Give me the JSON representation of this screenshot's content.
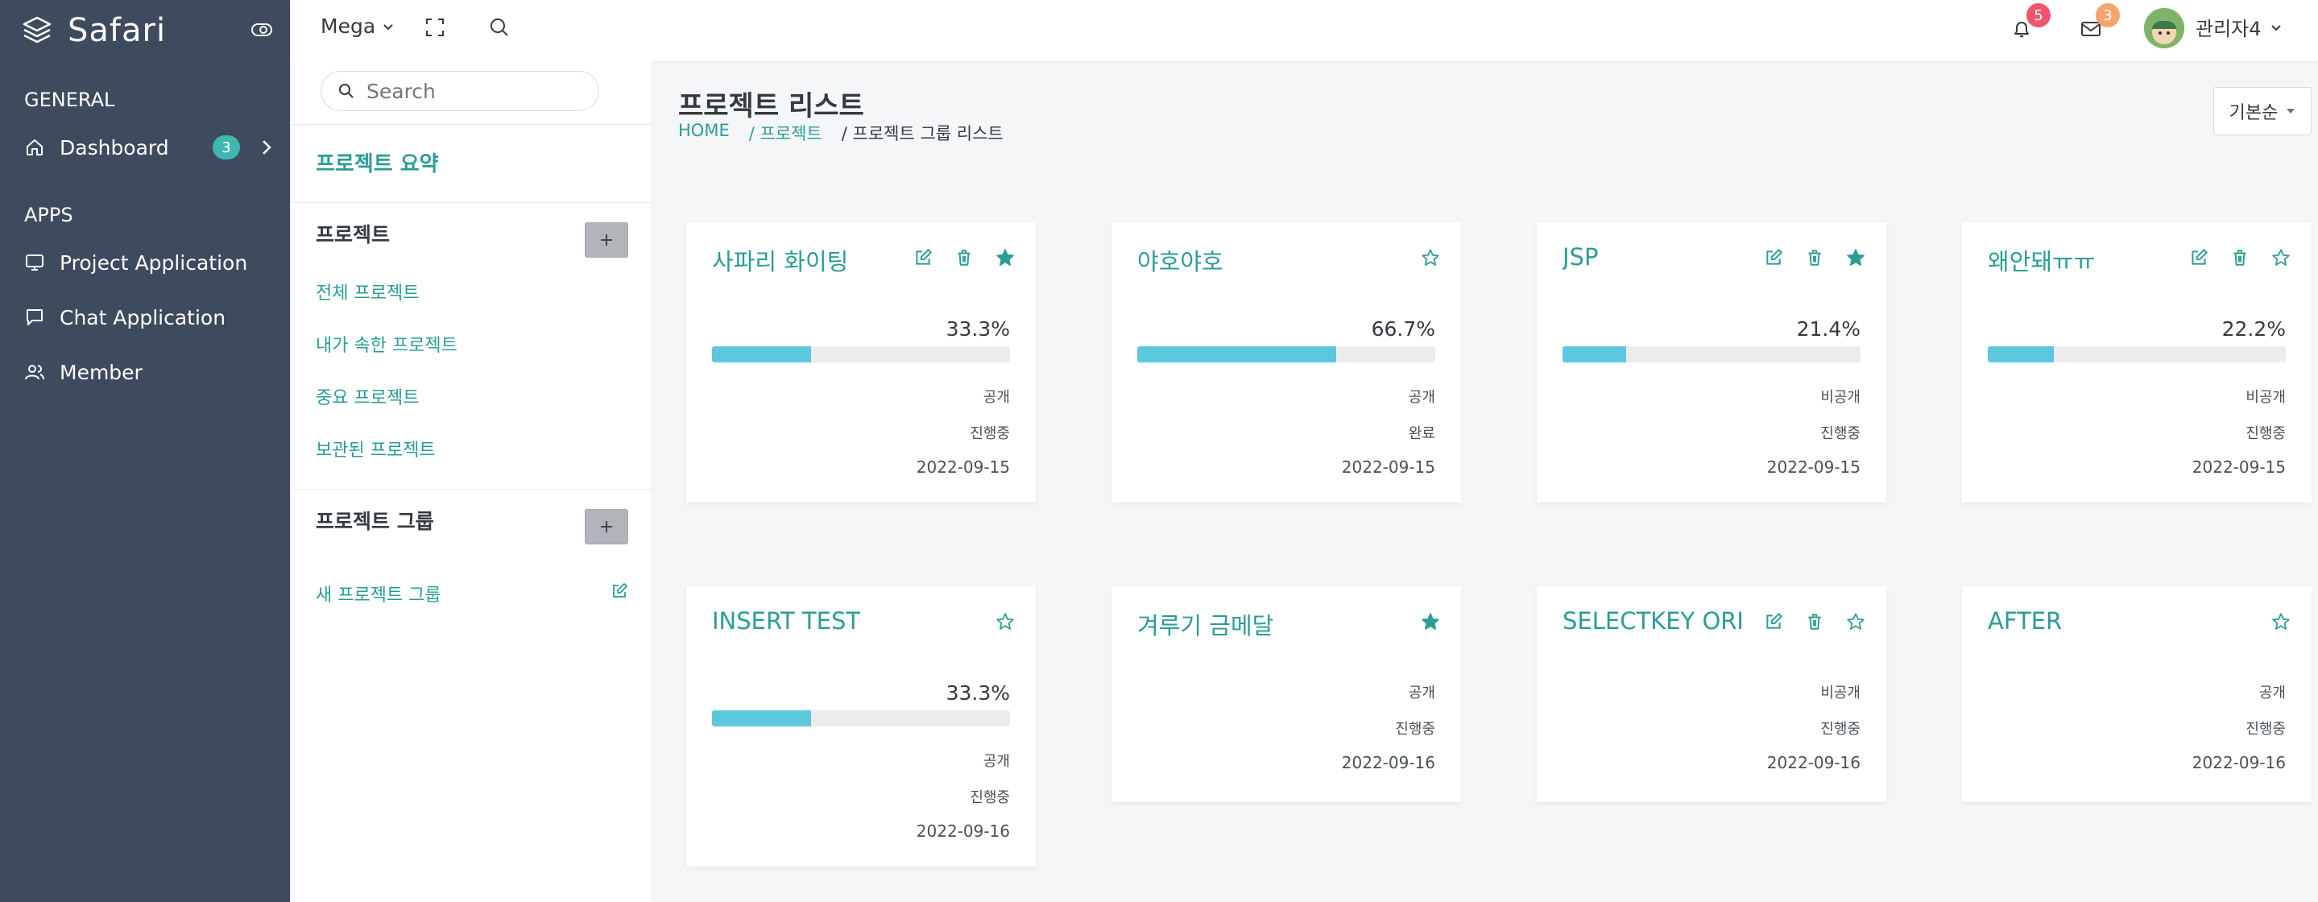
{
  "brand": {
    "name": "Safari"
  },
  "sidebar": {
    "general_title": "GENERAL",
    "dashboard_label": "Dashboard",
    "dashboard_badge": "3",
    "apps_title": "APPS",
    "apps": [
      {
        "label": "Project Application",
        "icon": "monitor-icon"
      },
      {
        "label": "Chat Application",
        "icon": "chat-icon"
      },
      {
        "label": "Member",
        "icon": "users-icon"
      }
    ]
  },
  "topbar": {
    "mega_label": "Mega",
    "notif_count": "5",
    "mail_count": "3",
    "username": "관리자4",
    "colors": {
      "notif": "#f1556c",
      "mail": "#f7a56d"
    }
  },
  "panel": {
    "search_placeholder": "Search",
    "summary_link": "프로젝트 요약",
    "projects_head": "프로젝트",
    "project_links": [
      "전체 프로젝트",
      "내가 속한 프로젝트",
      "중요 프로젝트",
      "보관된 프로젝트"
    ],
    "groups_head": "프로젝트 그룹",
    "new_group_link": "새 프로젝트 그룹"
  },
  "main": {
    "title": "프로젝트 리스트",
    "breadcrumb": [
      "HOME",
      "/ 프로젝트",
      "/ 프로젝트 그룹 리스트"
    ],
    "sort_label": "기본순"
  },
  "cards": [
    {
      "title": "사파리 화이팅",
      "editable": true,
      "starred": true,
      "progress_text": "33.3%",
      "progress": 0.333,
      "visibility": "공개",
      "status": "진행중",
      "date": "2022-09-15"
    },
    {
      "title": "야호야호",
      "editable": false,
      "starred": false,
      "progress_text": "66.7%",
      "progress": 0.667,
      "visibility": "공개",
      "status": "완료",
      "date": "2022-09-15"
    },
    {
      "title": "JSP",
      "editable": true,
      "starred": true,
      "progress_text": "21.4%",
      "progress": 0.214,
      "visibility": "비공개",
      "status": "진행중",
      "date": "2022-09-15"
    },
    {
      "title": "왜안돼ㅠㅠ",
      "editable": true,
      "starred": false,
      "progress_text": "22.2%",
      "progress": 0.222,
      "visibility": "비공개",
      "status": "진행중",
      "date": "2022-09-15"
    },
    {
      "title": "INSERT TEST",
      "editable": false,
      "starred": false,
      "progress_text": "33.3%",
      "progress": 0.333,
      "visibility": "공개",
      "status": "진행중",
      "date": "2022-09-16"
    },
    {
      "title": "겨루기 금메달",
      "editable": false,
      "starred": true,
      "progress_text": "",
      "progress": null,
      "visibility": "공개",
      "status": "진행중",
      "date": "2022-09-16"
    },
    {
      "title": "SELECTKEY ORI",
      "editable": true,
      "starred": false,
      "progress_text": "",
      "progress": null,
      "visibility": "비공개",
      "status": "진행중",
      "date": "2022-09-16"
    },
    {
      "title": "AFTER",
      "editable": false,
      "starred": false,
      "progress_text": "",
      "progress": null,
      "visibility": "공개",
      "status": "진행중",
      "date": "2022-09-16"
    }
  ],
  "colors": {
    "sidebar_bg": "#3e4a5e",
    "accent": "#2a9d95",
    "progress": "#5bc8dd"
  }
}
